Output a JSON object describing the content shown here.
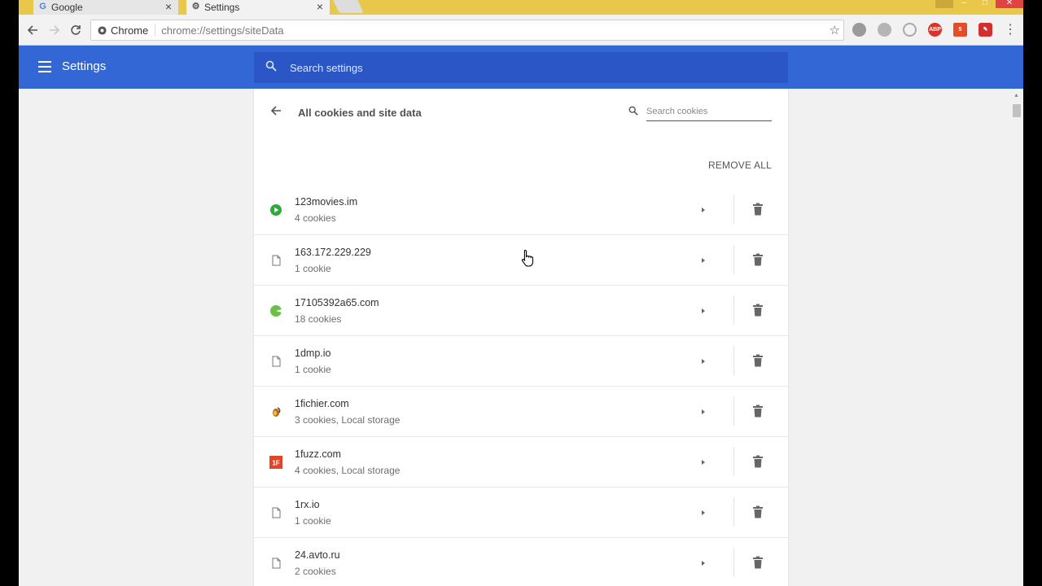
{
  "browser": {
    "tabs": [
      {
        "title": "Google",
        "icon": "google-icon"
      },
      {
        "title": "Settings",
        "icon": "gear-icon"
      }
    ],
    "close_glyph": "×",
    "omnibox": {
      "chip_label": "Chrome",
      "url": "chrome://settings/siteData"
    },
    "extensions": [
      "extension-icon",
      "globe-extension-icon",
      "circle-extension-icon",
      "adblock-plus-icon",
      "html5-icon",
      "pen-extension-icon"
    ]
  },
  "header": {
    "title": "Settings",
    "search_placeholder": "Search settings"
  },
  "page": {
    "title": "All cookies and site data",
    "search_placeholder": "Search cookies",
    "remove_all_label": "REMOVE ALL"
  },
  "sites": [
    {
      "name": "123movies.im",
      "detail": "4 cookies",
      "icon": "green-play-icon"
    },
    {
      "name": "163.172.229.229",
      "detail": "1 cookie",
      "icon": "document-icon"
    },
    {
      "name": "17105392a65.com",
      "detail": "18 cookies",
      "icon": "green-circle-icon"
    },
    {
      "name": "1dmp.io",
      "detail": "1 cookie",
      "icon": "document-icon"
    },
    {
      "name": "1fichier.com",
      "detail": "3 cookies, Local storage",
      "icon": "squirrel-icon"
    },
    {
      "name": "1fuzz.com",
      "detail": "4 cookies, Local storage",
      "icon": "1f-logo-icon"
    },
    {
      "name": "1rx.io",
      "detail": "1 cookie",
      "icon": "document-icon"
    },
    {
      "name": "24.avto.ru",
      "detail": "2 cookies",
      "icon": "document-icon"
    }
  ],
  "colors": {
    "header_blue": "#3367d6",
    "search_blue": "#2a56c6",
    "titlebar_yellow": "#e9c74a"
  }
}
